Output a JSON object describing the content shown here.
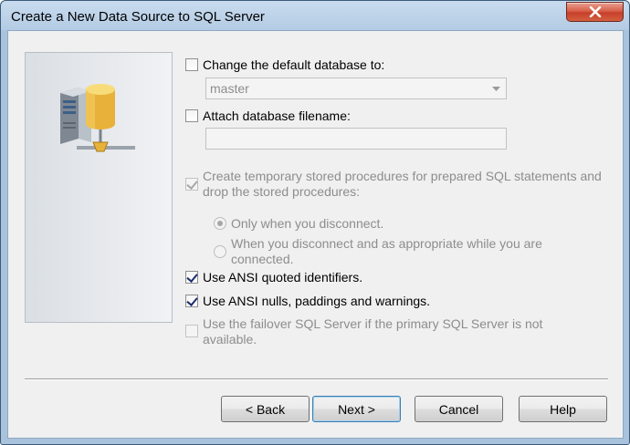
{
  "window": {
    "title": "Create a New Data Source to SQL Server"
  },
  "options": {
    "change_default_db": {
      "label": "Change the default database to:",
      "checked": false
    },
    "default_db_combo": {
      "value": "master"
    },
    "attach_db_filename": {
      "label": "Attach database filename:",
      "checked": false
    },
    "attach_db_input": {
      "value": ""
    },
    "create_temp_procs": {
      "label": "Create temporary stored procedures for prepared SQL statements and drop the stored procedures:",
      "checked": true,
      "disabled": true
    },
    "radio_only_disconnect": {
      "label": "Only when you disconnect.",
      "selected": true,
      "disabled": true
    },
    "radio_disconnect_and_appropriate": {
      "label": "When you disconnect and as appropriate while you are connected.",
      "selected": false,
      "disabled": true
    },
    "ansi_quoted": {
      "label": "Use ANSI quoted identifiers.",
      "checked": true
    },
    "ansi_nulls": {
      "label": "Use ANSI nulls, paddings and warnings.",
      "checked": true
    },
    "failover": {
      "label": "Use the failover SQL Server if the primary SQL Server is not available.",
      "checked": false,
      "disabled": true
    }
  },
  "buttons": {
    "back": "< Back",
    "next": "Next >",
    "cancel": "Cancel",
    "help": "Help"
  },
  "icons": {
    "close": "close-icon",
    "server": "database-server-icon",
    "dropdown": "chevron-down-icon"
  },
  "colors": {
    "title_bar": "#b3cbe4",
    "close_button": "#c7402a",
    "dialog_bg": "#f0f0f0",
    "disabled_text": "#8d8d8d",
    "default_button_border": "#3c7fb1"
  }
}
